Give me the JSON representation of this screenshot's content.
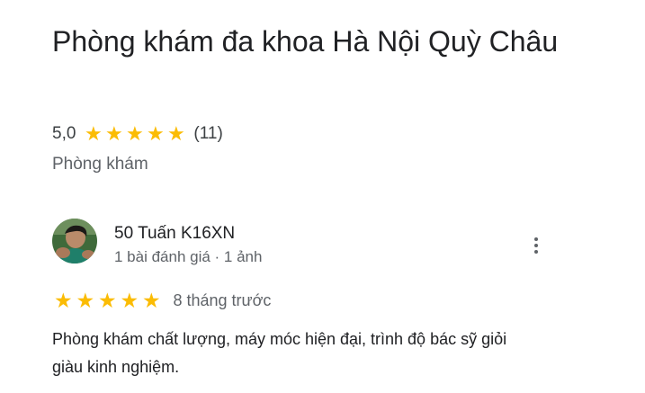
{
  "place": {
    "title": "Phòng khám đa khoa Hà Nội Quỳ Châu",
    "rating_value": "5,0",
    "star_count": 5,
    "review_count": "(11)",
    "category": "Phòng khám",
    "star_color": "#fbbc04"
  },
  "review": {
    "reviewer_name": "50 Tuấn K16XN",
    "reviewer_meta": "1 bài đánh giá · 1 ảnh",
    "stars": 5,
    "date": "8 tháng trước",
    "text": "Phòng khám chất lượng, máy móc hiện đại, trình độ bác sỹ giỏi giàu kinh nghiệm.",
    "more_icon": "more-vert-icon"
  }
}
